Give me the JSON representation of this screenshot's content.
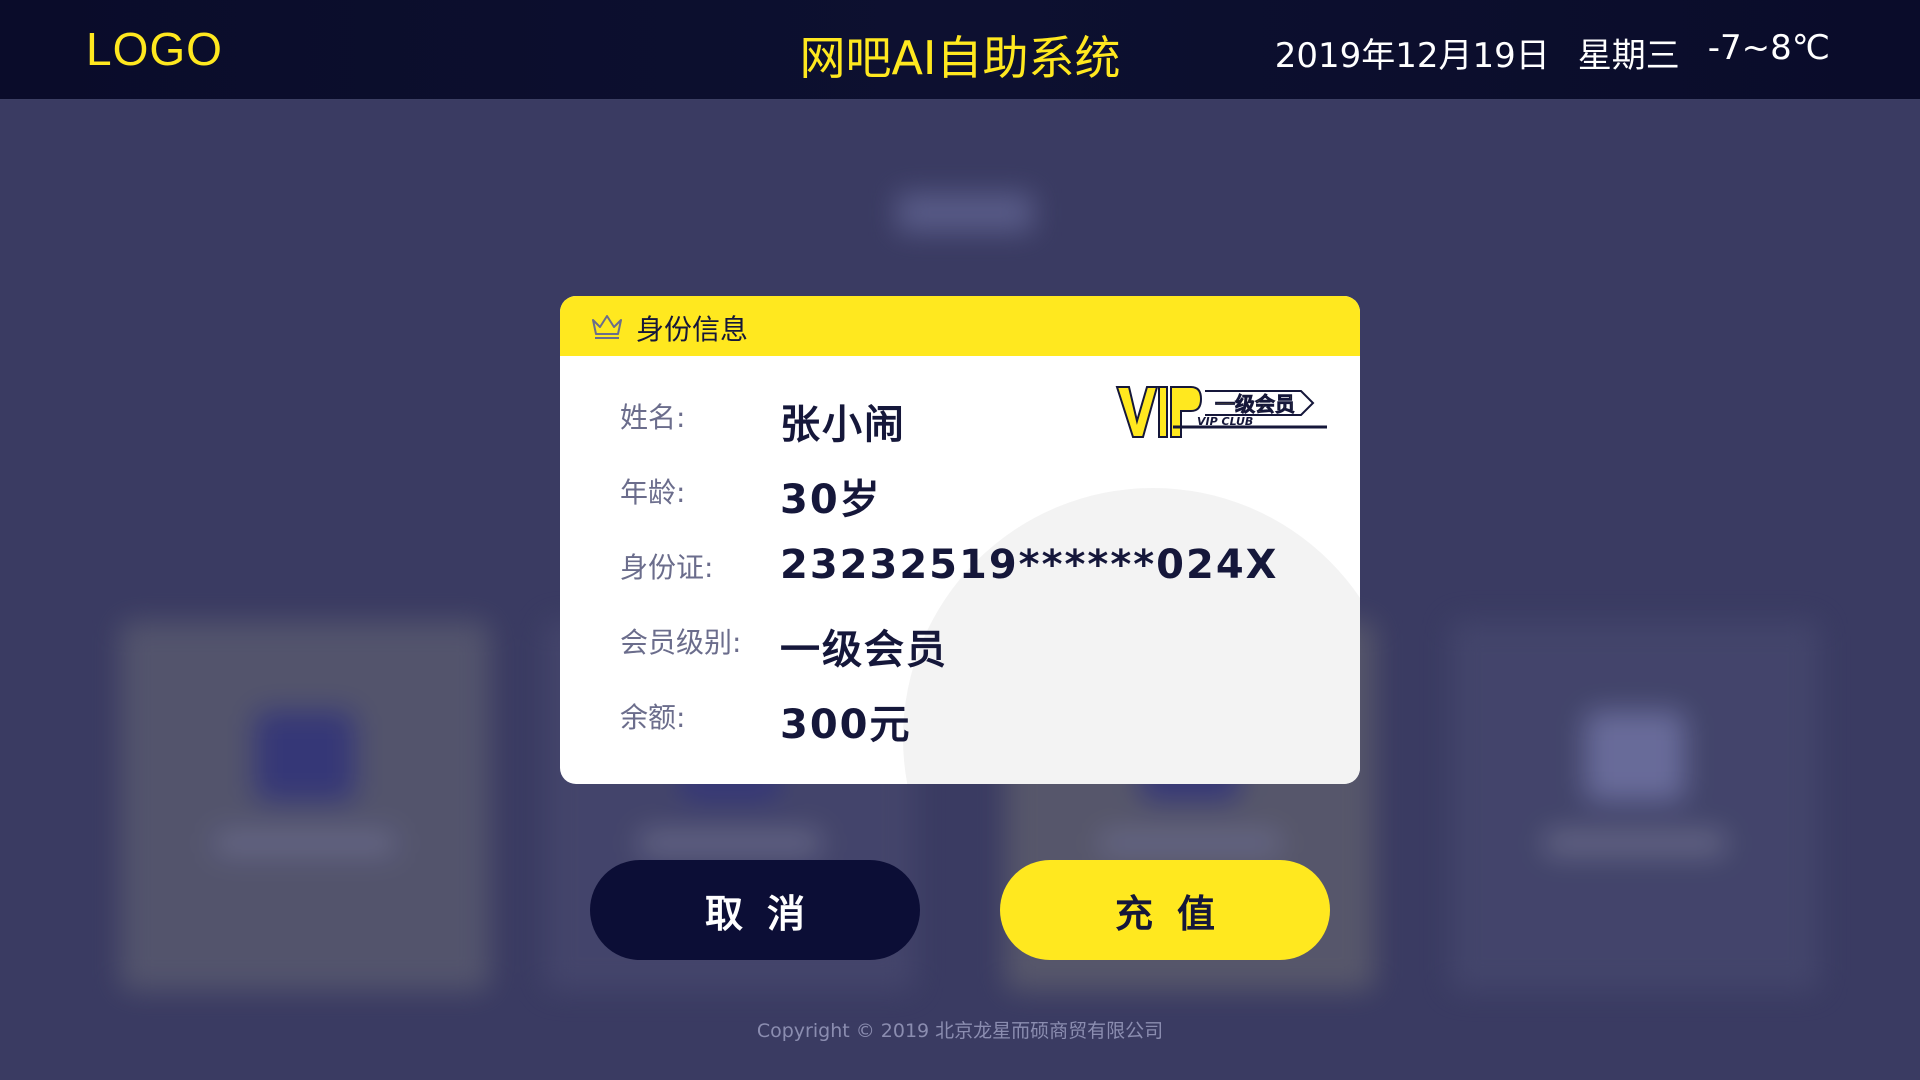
{
  "header": {
    "logo": "LOGO",
    "title": "网吧AI自助系统",
    "date": "2019年12月19日",
    "weekday": "星期三",
    "temperature": "-7~8℃"
  },
  "dialog": {
    "title": "身份信息",
    "badge": {
      "icon": "vip-club-badge",
      "level_text": "一级会员",
      "club_text": "VIP CLUB"
    },
    "fields": [
      {
        "label": "姓名:",
        "value": "张小闹"
      },
      {
        "label": "年龄:",
        "value": "30岁"
      },
      {
        "label": "身份证:",
        "value": "23232519******024X"
      },
      {
        "label": "会员级别:",
        "value": "一级会员"
      },
      {
        "label": "余额:",
        "value": "300元"
      }
    ]
  },
  "buttons": {
    "cancel": "取消",
    "recharge": "充值"
  },
  "footer": {
    "copyright": "Copyright © 2019  北京龙星而硕商贸有限公司"
  },
  "colors": {
    "accent": "#ffe81f",
    "navy": "#0c0e36",
    "background": "#3a3b62"
  }
}
